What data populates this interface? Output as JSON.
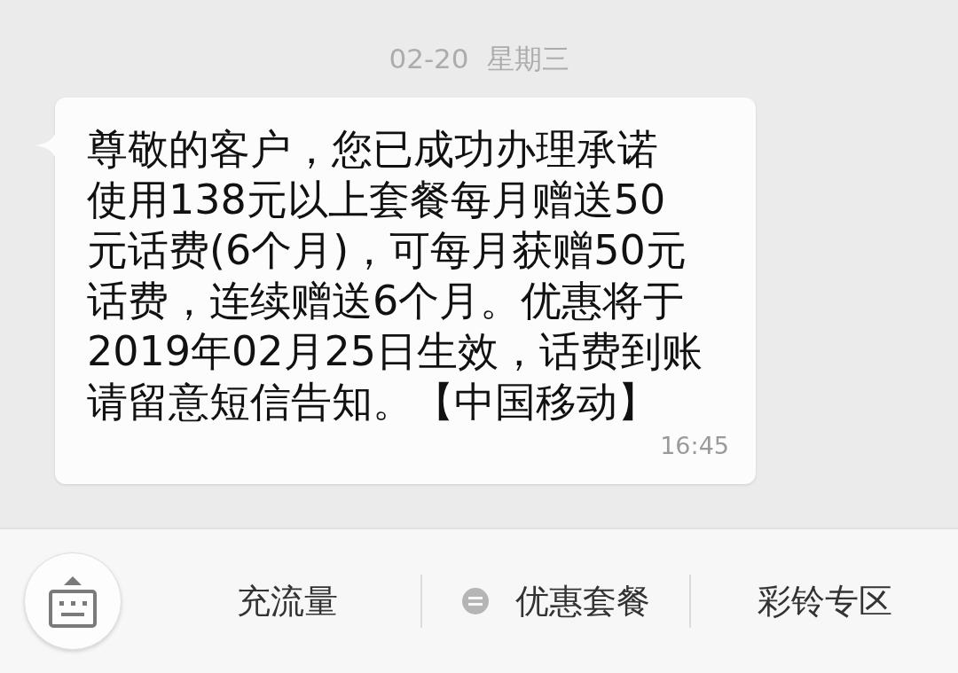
{
  "date_header": {
    "date": "02-20",
    "weekday": "星期三"
  },
  "message": {
    "lines": [
      "尊敬的客户，您已成功办理承诺",
      "使用138元以上套餐每月赠送50",
      "元话费(6个月)，可每月获赠50元",
      "话费，连续赠送6个月。优惠将于",
      "2019年02月25日生效，话费到账",
      "请留意短信告知。【中国移动】"
    ],
    "time": "16:45"
  },
  "bottom_menu": [
    {
      "kind": "plain",
      "label": "充流量"
    },
    {
      "kind": "with-icon",
      "label": "优惠套餐"
    },
    {
      "kind": "plain",
      "label": "彩铃专区"
    }
  ]
}
